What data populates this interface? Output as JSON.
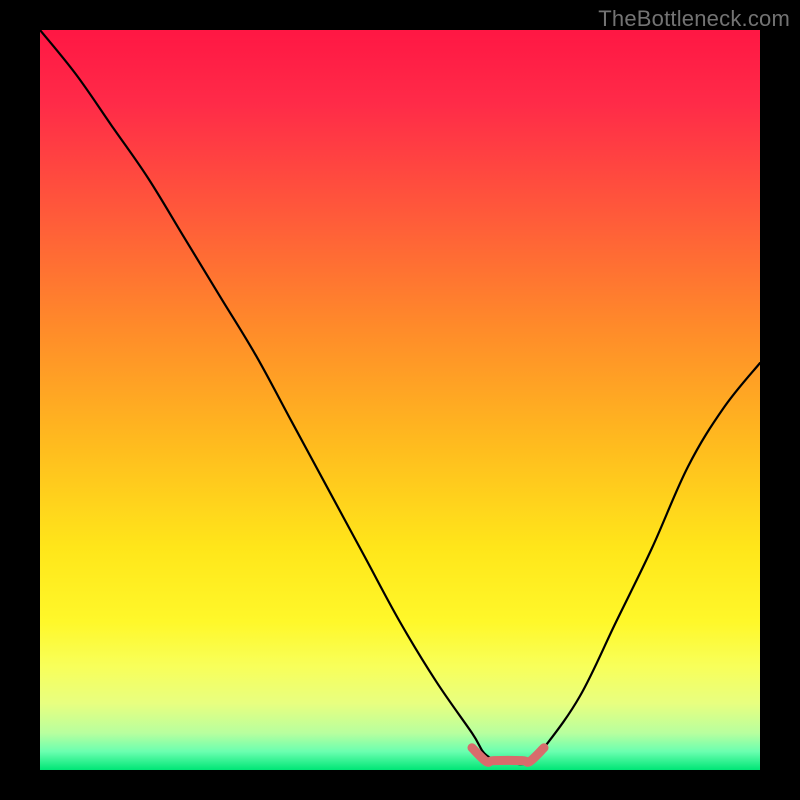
{
  "watermark": "TheBottleneck.com",
  "chart_data": {
    "type": "line",
    "title": "",
    "xlabel": "",
    "ylabel": "",
    "xlim": [
      0,
      100
    ],
    "ylim": [
      0,
      100
    ],
    "x": [
      0,
      5,
      10,
      15,
      20,
      25,
      30,
      35,
      40,
      45,
      50,
      55,
      60,
      62,
      65,
      68,
      70,
      75,
      80,
      85,
      90,
      95,
      100
    ],
    "values": [
      100,
      94,
      87,
      80,
      72,
      64,
      56,
      47,
      38,
      29,
      20,
      12,
      5,
      2,
      1,
      1,
      3,
      10,
      20,
      30,
      41,
      49,
      55
    ],
    "highlight": {
      "x_range": [
        60,
        70
      ],
      "y": 1,
      "color": "#d86c6c"
    },
    "background_gradient": {
      "stops": [
        {
          "offset": 0.0,
          "color": "#ff1744"
        },
        {
          "offset": 0.1,
          "color": "#ff2b48"
        },
        {
          "offset": 0.25,
          "color": "#ff5a3a"
        },
        {
          "offset": 0.4,
          "color": "#ff8a2a"
        },
        {
          "offset": 0.55,
          "color": "#ffb81f"
        },
        {
          "offset": 0.7,
          "color": "#ffe61a"
        },
        {
          "offset": 0.8,
          "color": "#fff82a"
        },
        {
          "offset": 0.86,
          "color": "#f8ff5a"
        },
        {
          "offset": 0.91,
          "color": "#e8ff80"
        },
        {
          "offset": 0.95,
          "color": "#b8ff9e"
        },
        {
          "offset": 0.975,
          "color": "#6bffb0"
        },
        {
          "offset": 1.0,
          "color": "#00e676"
        }
      ]
    }
  }
}
